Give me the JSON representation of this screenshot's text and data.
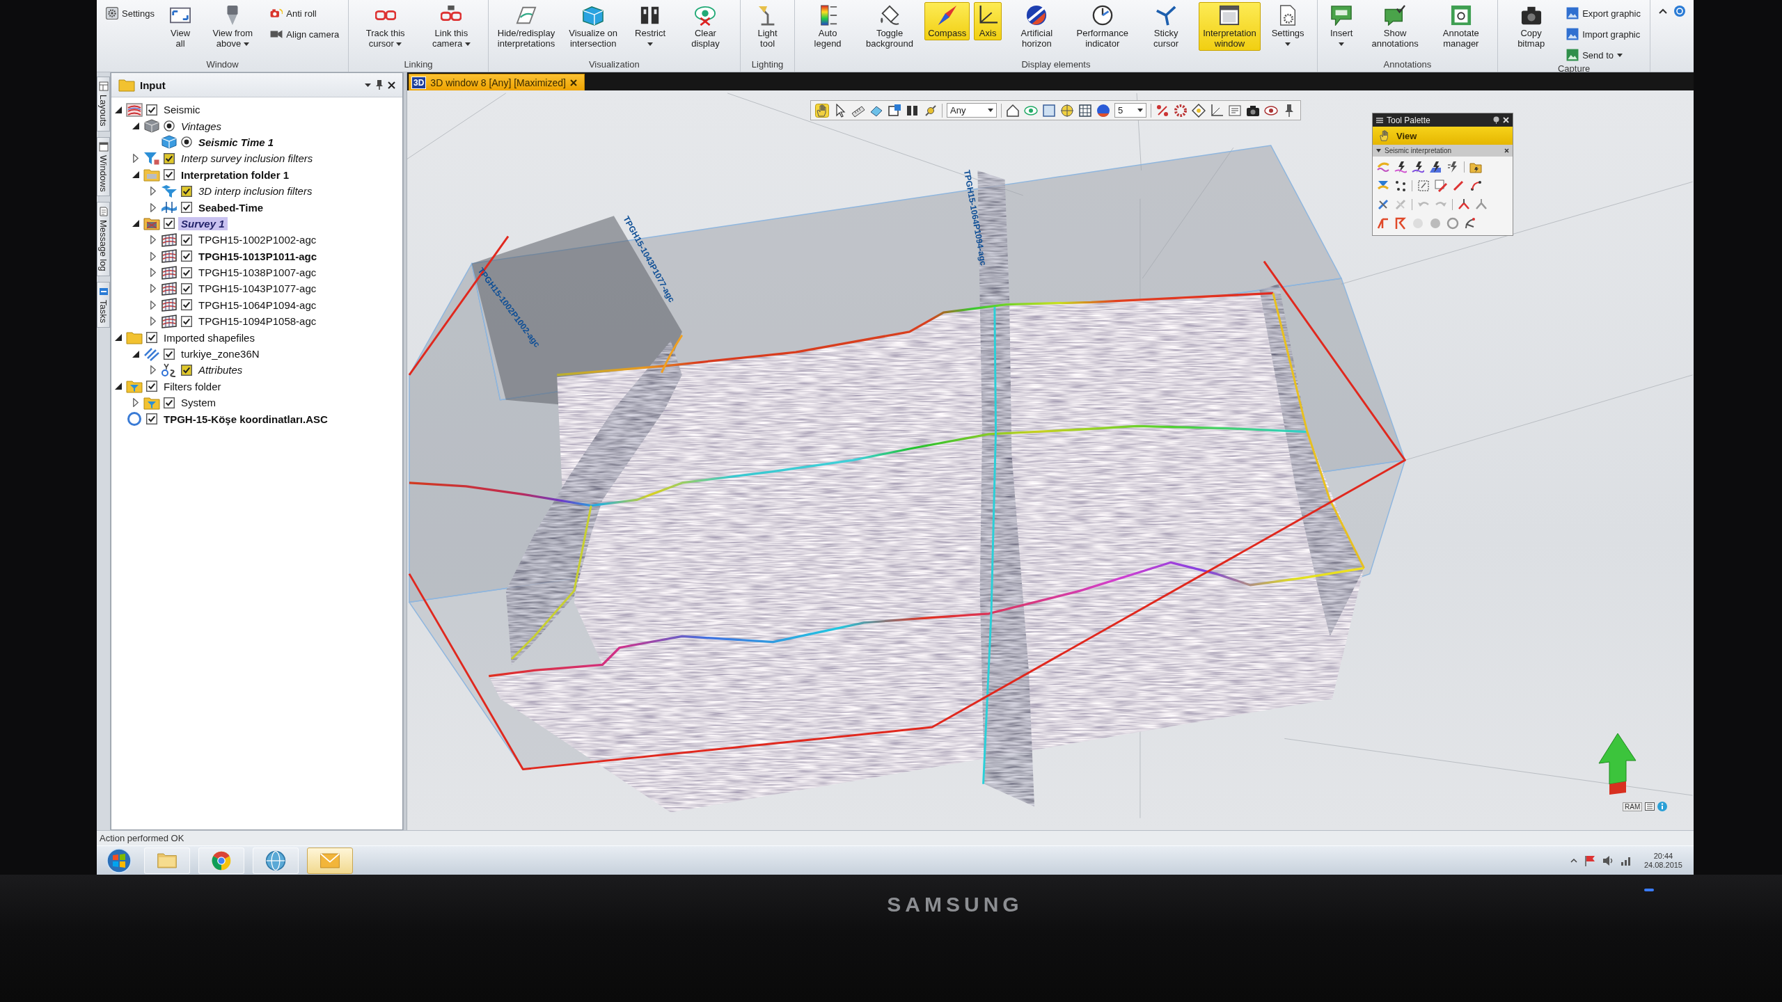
{
  "ribbon": {
    "groups": [
      {
        "label": "Window",
        "items": [
          {
            "kind": "small",
            "label": "Settings",
            "dropdown": false
          },
          {
            "kind": "large",
            "label": "View all",
            "dropdown": false
          },
          {
            "kind": "large",
            "label": "View from above",
            "dropdown": true
          },
          {
            "kind": "small",
            "label": "Anti roll",
            "dropdown": false
          },
          {
            "kind": "small",
            "label": "Align camera",
            "dropdown": false
          }
        ]
      },
      {
        "label": "Linking",
        "items": [
          {
            "kind": "large",
            "label": "Track this cursor",
            "dropdown": true
          },
          {
            "kind": "large",
            "label": "Link this camera",
            "dropdown": true
          }
        ]
      },
      {
        "label": "Visualization",
        "items": [
          {
            "kind": "large",
            "label": "Hide/redisplay interpretations",
            "dropdown": false
          },
          {
            "kind": "large",
            "label": "Visualize on intersection",
            "dropdown": false
          },
          {
            "kind": "large",
            "label": "Restrict",
            "dropdown": true
          },
          {
            "kind": "large",
            "label": "Clear display",
            "dropdown": false
          }
        ]
      },
      {
        "label": "Lighting",
        "items": [
          {
            "kind": "large",
            "label": "Light tool",
            "dropdown": false
          }
        ]
      },
      {
        "label": "Display elements",
        "items": [
          {
            "kind": "toggle",
            "label": "Auto legend",
            "on": false,
            "dropdown": false
          },
          {
            "kind": "toggle",
            "label": "Toggle background",
            "on": false,
            "dropdown": false
          },
          {
            "kind": "toggle",
            "label": "Compass",
            "on": true,
            "dropdown": false
          },
          {
            "kind": "toggle",
            "label": "Axis",
            "on": true,
            "dropdown": false
          },
          {
            "kind": "toggle",
            "label": "Artificial horizon",
            "on": false,
            "dropdown": false
          },
          {
            "kind": "toggle",
            "label": "Performance indicator",
            "on": false,
            "dropdown": false
          },
          {
            "kind": "toggle",
            "label": "Sticky cursor",
            "on": false,
            "dropdown": false
          },
          {
            "kind": "toggle",
            "label": "Interpretation window",
            "on": true,
            "dropdown": false
          },
          {
            "kind": "large",
            "label": "Settings",
            "dropdown": true
          }
        ]
      },
      {
        "label": "Annotations",
        "items": [
          {
            "kind": "large",
            "label": "Insert",
            "dropdown": true
          },
          {
            "kind": "large",
            "label": "Show annotations",
            "dropdown": false
          },
          {
            "kind": "large",
            "label": "Annotate manager",
            "dropdown": false
          }
        ]
      },
      {
        "label": "Capture",
        "items": [
          {
            "kind": "large",
            "label": "Copy bitmap",
            "dropdown": false
          },
          {
            "kind": "small",
            "label": "Export graphic",
            "dropdown": false
          },
          {
            "kind": "small",
            "label": "Import graphic",
            "dropdown": false
          },
          {
            "kind": "small",
            "label": "Send to",
            "dropdown": true
          }
        ]
      }
    ]
  },
  "side_tabs": [
    "Layouts",
    "Windows",
    "Message log",
    "Tasks"
  ],
  "input_panel": {
    "title": "Input",
    "tree": [
      {
        "label": "Seismic",
        "kind": "seismic",
        "radio": false,
        "filter_toggle": false,
        "checked": true,
        "expanded": true,
        "active": false,
        "virtual": false,
        "selected": false,
        "children": [
          {
            "label": "Vintages",
            "kind": "vintages",
            "radio": true,
            "filter_toggle": false,
            "checked": true,
            "expanded": true,
            "active": false,
            "virtual": true,
            "selected": false,
            "children": [
              {
                "label": "Seismic Time 1",
                "kind": "seismic-cube",
                "radio": true,
                "filter_toggle": false,
                "checked": true,
                "active": true,
                "virtual": true,
                "selected": false
              }
            ]
          },
          {
            "label": "Interp survey inclusion filters",
            "kind": "filter",
            "radio": false,
            "filter_toggle": true,
            "checked": true,
            "expanded": false,
            "active": false,
            "virtual": true,
            "selected": false
          },
          {
            "label": "Interpretation folder 1",
            "kind": "interp-folder",
            "radio": false,
            "filter_toggle": false,
            "checked": true,
            "expanded": true,
            "active": true,
            "virtual": false,
            "selected": false,
            "children": [
              {
                "label": "3D interp inclusion filters",
                "kind": "filter-3d",
                "radio": false,
                "filter_toggle": true,
                "checked": true,
                "expanded": false,
                "active": false,
                "virtual": true,
                "selected": false
              },
              {
                "label": "Seabed-Time",
                "kind": "horizon",
                "radio": false,
                "filter_toggle": false,
                "checked": true,
                "expanded": false,
                "active": true,
                "virtual": false,
                "selected": false
              }
            ]
          },
          {
            "label": "Survey 1",
            "kind": "survey",
            "radio": false,
            "filter_toggle": false,
            "checked": true,
            "expanded": true,
            "active": true,
            "virtual": true,
            "selected": true,
            "children": [
              {
                "label": "TPGH15-1002P1002-agc",
                "kind": "seismic-line",
                "radio": false,
                "filter_toggle": false,
                "checked": true,
                "expanded": false,
                "active": false,
                "virtual": false,
                "selected": false
              },
              {
                "label": "TPGH15-1013P1011-agc",
                "kind": "seismic-line",
                "radio": false,
                "filter_toggle": false,
                "checked": true,
                "expanded": false,
                "active": true,
                "virtual": false,
                "selected": false
              },
              {
                "label": "TPGH15-1038P1007-agc",
                "kind": "seismic-line",
                "radio": false,
                "filter_toggle": false,
                "checked": true,
                "expanded": false,
                "active": false,
                "virtual": false,
                "selected": false
              },
              {
                "label": "TPGH15-1043P1077-agc",
                "kind": "seismic-line",
                "radio": false,
                "filter_toggle": false,
                "checked": true,
                "expanded": false,
                "active": false,
                "virtual": false,
                "selected": false
              },
              {
                "label": "TPGH15-1064P1094-agc",
                "kind": "seismic-line",
                "radio": false,
                "filter_toggle": false,
                "checked": true,
                "expanded": false,
                "active": false,
                "virtual": false,
                "selected": false
              },
              {
                "label": "TPGH15-1094P1058-agc",
                "kind": "seismic-line",
                "radio": false,
                "filter_toggle": false,
                "checked": true,
                "expanded": false,
                "active": false,
                "virtual": false,
                "selected": false
              }
            ]
          }
        ]
      },
      {
        "label": "Imported shapefiles",
        "kind": "folder",
        "radio": false,
        "filter_toggle": false,
        "checked": true,
        "expanded": true,
        "active": false,
        "virtual": false,
        "selected": false,
        "children": [
          {
            "label": "turkiye_zone36N",
            "kind": "polyline",
            "radio": false,
            "filter_toggle": false,
            "checked": true,
            "expanded": true,
            "active": false,
            "virtual": false,
            "selected": false,
            "children": [
              {
                "label": "Attributes",
                "kind": "attributes",
                "radio": false,
                "filter_toggle": true,
                "checked": true,
                "expanded": false,
                "active": false,
                "virtual": true,
                "selected": false
              }
            ]
          }
        ]
      },
      {
        "label": "Filters folder",
        "kind": "filter-folder",
        "radio": false,
        "filter_toggle": false,
        "checked": true,
        "expanded": true,
        "active": false,
        "virtual": false,
        "selected": false,
        "children": [
          {
            "label": "System",
            "kind": "filter-folder",
            "radio": false,
            "filter_toggle": false,
            "checked": true,
            "expanded": false,
            "active": false,
            "virtual": false,
            "selected": false
          }
        ]
      },
      {
        "label": "TPGH-15-Köşe koordinatları.ASC",
        "kind": "points",
        "radio": false,
        "filter_toggle": false,
        "checked": true,
        "active": true,
        "virtual": false,
        "selected": false
      }
    ]
  },
  "view_window": {
    "tab": {
      "badge": "3D",
      "title": "3D window 8 [Any] [Maximized]"
    },
    "toolbar": {
      "tools": [
        {
          "selected": true
        },
        {
          "selected": false
        },
        {
          "selected": false
        },
        {
          "selected": false
        },
        {
          "selected": false
        },
        {
          "selected": false
        },
        {
          "selected": false
        }
      ],
      "domain": "Any",
      "number": "5"
    },
    "line_labels": [
      "TPGH15-1002P1002-agc",
      "TPGH15-1043P1077-agc",
      "TPGH15-1064P1094-agc"
    ],
    "tool_palette": {
      "title": "Tool Palette",
      "section": {
        "label": "View",
        "selected": true
      },
      "subsection": "Seismic interpretation"
    },
    "memory_label": "RAM"
  },
  "status_bar": {
    "message": "Action performed OK"
  },
  "taskbar": {
    "apps": [
      {
        "active": false
      },
      {
        "active": false
      },
      {
        "active": false
      },
      {
        "active": true
      }
    ],
    "time": "20:44",
    "date": "24.08.2015"
  },
  "monitor": {
    "brand": "SAMSUNG"
  }
}
